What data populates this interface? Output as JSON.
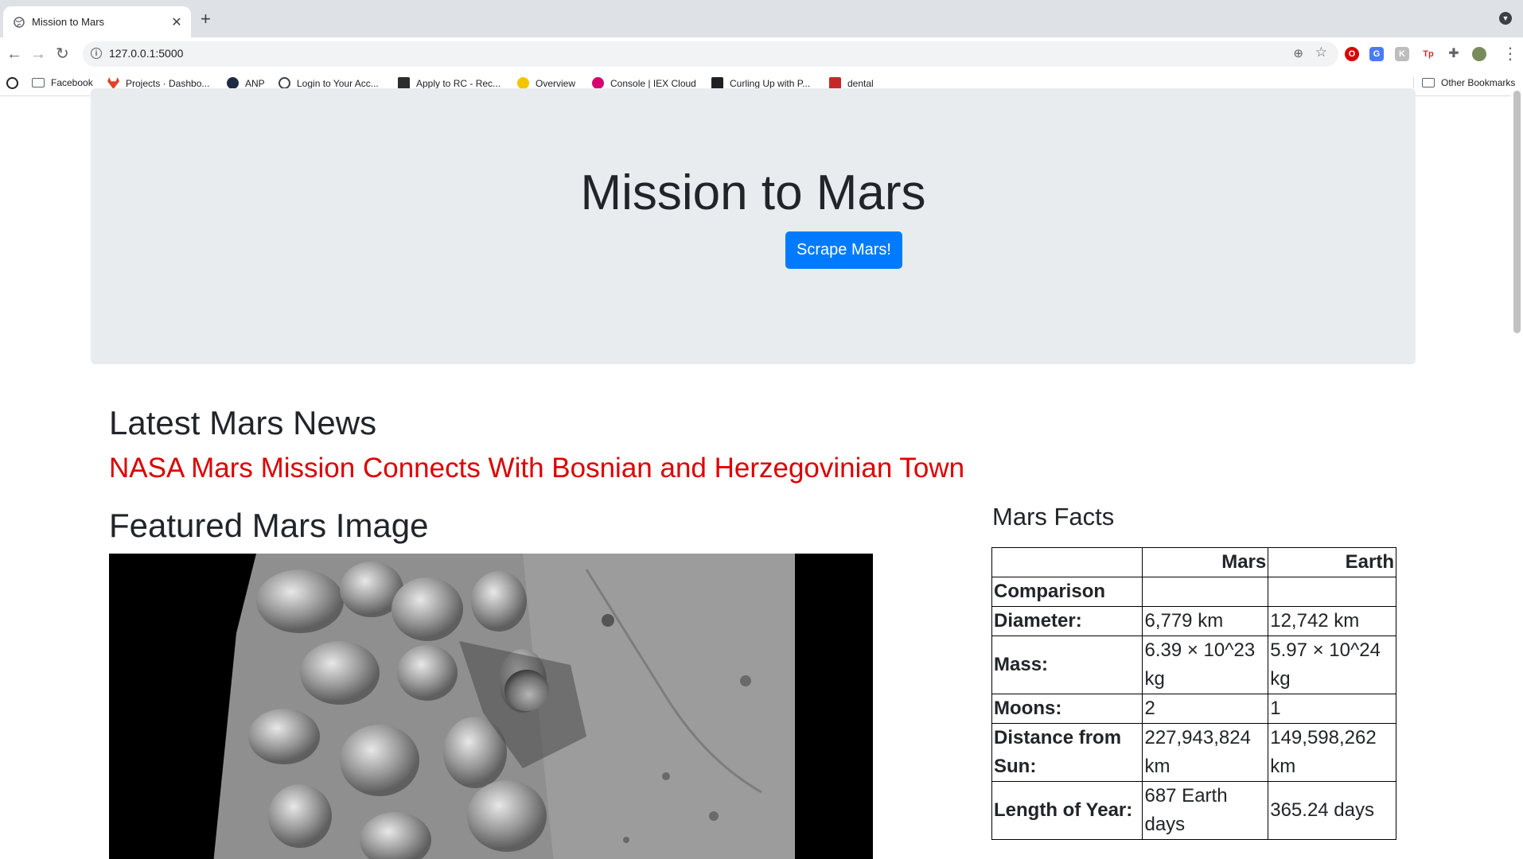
{
  "browser": {
    "tab_title": "Mission to Mars",
    "url": "127.0.0.1:5000",
    "bookmarks": [
      "Facebook",
      "Projects · Dashbo...",
      "ANP",
      "Login to Your Acc...",
      "Apply to RC - Rec...",
      "Overview",
      "Console | IEX Cloud",
      "Curling Up with P...",
      "dental"
    ],
    "other_bookmarks": "Other Bookmarks",
    "extension_label": "Tp"
  },
  "page": {
    "title": "Mission to Mars",
    "scrape_button": "Scrape Mars!",
    "news_heading": "Latest Mars News",
    "news_title": "NASA Mars Mission Connects With Bosnian and Herzegovinian Town",
    "image_heading": "Featured Mars Image",
    "facts_heading": "Mars Facts",
    "facts_table": {
      "columns": [
        "",
        "Mars",
        "Earth"
      ],
      "rows": [
        {
          "label": "Comparison",
          "mars": "",
          "earth": ""
        },
        {
          "label": "Diameter:",
          "mars": "6,779 km",
          "earth": "12,742 km"
        },
        {
          "label": "Mass:",
          "mars": "6.39 × 10^23 kg",
          "earth": "5.97 × 10^24 kg"
        },
        {
          "label": "Moons:",
          "mars": "2",
          "earth": "1"
        },
        {
          "label": "Distance from Sun:",
          "mars": "227,943,824 km",
          "earth": "149,598,262 km"
        },
        {
          "label": "Length of Year:",
          "mars": "687 Earth days",
          "earth": "365.24 days"
        }
      ]
    }
  },
  "colors": {
    "button": "#007bff",
    "headline": "#dc0000",
    "jumbotron": "#e9ecef"
  }
}
